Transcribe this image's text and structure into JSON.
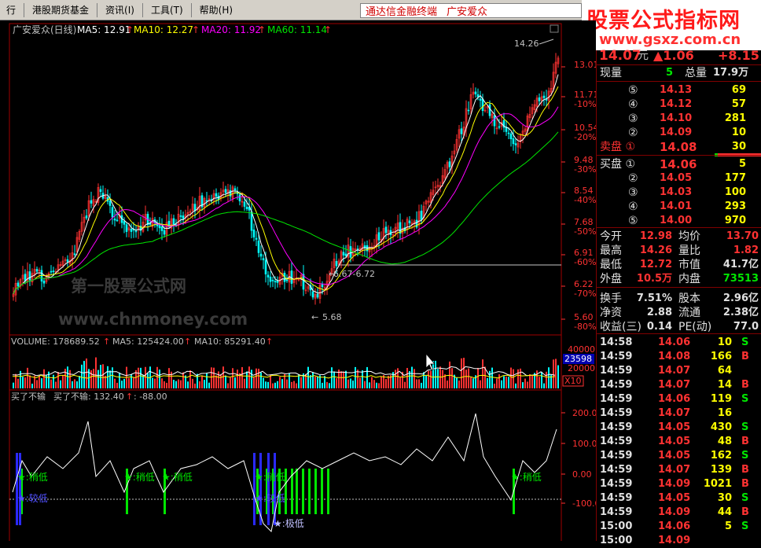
{
  "menu": [
    "行",
    "港股期货基金",
    "资讯(I)",
    "工具(T)",
    "帮助(H)"
  ],
  "title_bar": {
    "left": "通达信金融终端",
    "right": "广安爱众"
  },
  "banner": {
    "title": "股票公式指标网",
    "url": "www.gsxz.com.cn"
  },
  "main_legend": {
    "name": "广安爱众(日线)",
    "ma5": "MA5: 12.91",
    "ma10": "MA10: 12.27",
    "ma20": "MA20: 11.92",
    "ma60": "MA60: 11.14"
  },
  "price_axis": [
    {
      "price": "13.01",
      "pct": ""
    },
    {
      "price": "11.71",
      "pct": "-10%"
    },
    {
      "price": "10.54",
      "pct": "-20%"
    },
    {
      "price": "9.48",
      "pct": "-30%"
    },
    {
      "price": "8.54",
      "pct": "-40%"
    },
    {
      "price": "7.68",
      "pct": "-50%"
    },
    {
      "price": "6.91",
      "pct": "-60%"
    },
    {
      "price": "6.22",
      "pct": "-70%"
    },
    {
      "price": "5.60",
      "pct": "-80%"
    }
  ],
  "annotations": {
    "high": "14.26",
    "low": "5.68",
    "range": "6.67-6.72",
    "watermark_cn": "第一股票公式网",
    "watermark_url": "www.chnmoney.com"
  },
  "volume_legend": {
    "label": "VOLUME: 178689.52",
    "ma5": "MA5: 125424.00",
    "ma10": "MA10: 85291.40"
  },
  "volume_axis": [
    "40000",
    "20000",
    "X10"
  ],
  "volume_box": "23598",
  "indicator_legend": {
    "name": "买了不输",
    "label": "买了不输: 132.40",
    "value": ": -88.00"
  },
  "indicator_axis": [
    "200.00",
    "100.00",
    "0.00",
    "-100.00"
  ],
  "indicator_labels": {
    "low": "★:稍低",
    "lower": "★:较低",
    "lowest": "★:极低"
  },
  "quote": {
    "price": "14.07",
    "unit": "元",
    "change": "▲1.06",
    "change_pct": "+8.15",
    "xianliang_label": "现量",
    "xianliang": "5",
    "zongliang_label": "总量",
    "zongliang": "17.9万",
    "sell": [
      {
        "lvl": "⑤",
        "price": "14.13",
        "vol": "69"
      },
      {
        "lvl": "④",
        "price": "14.12",
        "vol": "57"
      },
      {
        "lvl": "③",
        "price": "14.10",
        "vol": "281"
      },
      {
        "lvl": "②",
        "price": "14.09",
        "vol": "10"
      },
      {
        "lvl": "卖盘 ①",
        "price": "14.08",
        "vol": "30"
      }
    ],
    "buy": [
      {
        "lvl": "买盘 ①",
        "price": "14.06",
        "vol": "5"
      },
      {
        "lvl": "②",
        "price": "14.05",
        "vol": "177"
      },
      {
        "lvl": "③",
        "price": "14.03",
        "vol": "100"
      },
      {
        "lvl": "④",
        "price": "14.01",
        "vol": "293"
      },
      {
        "lvl": "⑤",
        "price": "14.00",
        "vol": "970"
      }
    ],
    "stats": [
      [
        "今开",
        "12.98",
        "均价",
        "13.70"
      ],
      [
        "最高",
        "14.26",
        "量比",
        "1.82"
      ],
      [
        "最低",
        "12.72",
        "市值",
        "41.7亿"
      ],
      [
        "外盘",
        "10.5万",
        "内盘",
        "73513"
      ],
      [
        "换手",
        "7.51%",
        "股本",
        "2.96亿"
      ],
      [
        "净资",
        "2.88",
        "流通",
        "2.38亿"
      ],
      [
        "收益(三)",
        "0.14",
        "PE(动)",
        "77.0"
      ]
    ],
    "ticks": [
      [
        "14:58",
        "14.06",
        "10",
        "S"
      ],
      [
        "14:59",
        "14.08",
        "166",
        "B"
      ],
      [
        "14:59",
        "14.07",
        "64",
        ""
      ],
      [
        "14:59",
        "14.07",
        "14",
        "B"
      ],
      [
        "14:59",
        "14.06",
        "119",
        "S"
      ],
      [
        "14:59",
        "14.07",
        "16",
        ""
      ],
      [
        "14:59",
        "14.05",
        "430",
        "S"
      ],
      [
        "14:59",
        "14.05",
        "48",
        "B"
      ],
      [
        "14:59",
        "14.05",
        "162",
        "S"
      ],
      [
        "14:59",
        "14.07",
        "139",
        "B"
      ],
      [
        "14:59",
        "14.09",
        "1021",
        "B"
      ],
      [
        "14:59",
        "14.05",
        "30",
        "S"
      ],
      [
        "14:59",
        "14.09",
        "44",
        "B"
      ],
      [
        "15:00",
        "14.06",
        "5",
        "S"
      ],
      [
        "15:00",
        "14.09",
        "",
        ""
      ]
    ]
  },
  "colors": {
    "up": "#ff3232",
    "down": "#00ffff",
    "ma5": "#ffffff",
    "ma10": "#ffff00",
    "ma20": "#ff00ff",
    "ma60": "#00e600"
  }
}
